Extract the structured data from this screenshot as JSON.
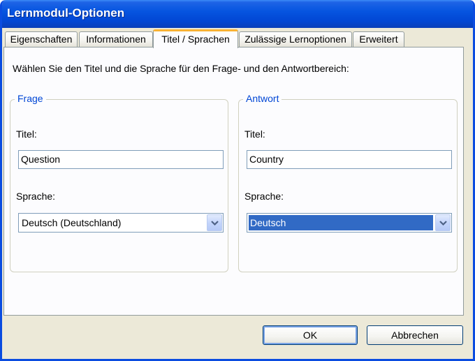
{
  "window": {
    "title": "Lernmodul-Optionen"
  },
  "tabs": [
    {
      "label": "Eigenschaften",
      "active": false
    },
    {
      "label": "Informationen",
      "active": false
    },
    {
      "label": "Titel / Sprachen",
      "active": true
    },
    {
      "label": "Zulässige Lernoptionen",
      "active": false
    },
    {
      "label": "Erweitert",
      "active": false
    }
  ],
  "panel": {
    "intro": "Wählen Sie den Titel und die Sprache für den Frage- und den Antwortbereich:"
  },
  "question": {
    "legend": "Frage",
    "title_label": "Titel:",
    "title_value": "Question",
    "language_label": "Sprache:",
    "language_value": "Deutsch (Deutschland)"
  },
  "answer": {
    "legend": "Antwort",
    "title_label": "Titel:",
    "title_value": "Country",
    "language_label": "Sprache:",
    "language_value": "Deutsch"
  },
  "buttons": {
    "ok": "OK",
    "cancel": "Abbrechen"
  },
  "colors": {
    "accent": "#0046d5",
    "selection": "#316ac5",
    "active_tab_highlight": "#f9b233"
  }
}
